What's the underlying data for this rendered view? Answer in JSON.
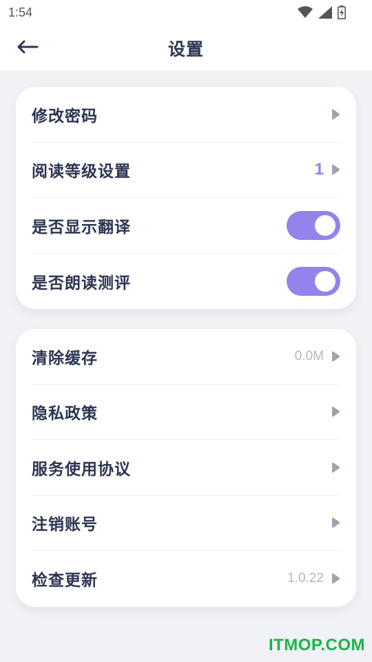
{
  "status_bar": {
    "time": "1:54",
    "icons": [
      "wifi-icon",
      "cellular-signal-icon",
      "battery-charging-icon"
    ]
  },
  "header": {
    "back_icon": "back-arrow-icon",
    "title": "设置"
  },
  "card1": {
    "items": [
      {
        "label": "修改密码",
        "value": "",
        "control": "arrow"
      },
      {
        "label": "阅读等级设置",
        "value": "1",
        "control": "arrow"
      },
      {
        "label": "是否显示翻译",
        "control": "toggle",
        "on": true
      },
      {
        "label": "是否朗读测评",
        "control": "toggle",
        "on": true
      }
    ]
  },
  "card2": {
    "items": [
      {
        "label": "清除缓存",
        "value": "0.0M",
        "control": "arrow"
      },
      {
        "label": "隐私政策",
        "value": "",
        "control": "arrow"
      },
      {
        "label": "服务使用协议",
        "value": "",
        "control": "arrow"
      },
      {
        "label": "注销账号",
        "value": "",
        "control": "arrow"
      },
      {
        "label": "检查更新",
        "value": "1.0.22",
        "control": "arrow"
      }
    ]
  },
  "watermark": "ITMOP.COM",
  "colors": {
    "accent": "#9284ec",
    "text": "#2c3550",
    "muted": "#b3b6c2",
    "background": "#f1f2f5",
    "watermark": "#1ab34a"
  }
}
